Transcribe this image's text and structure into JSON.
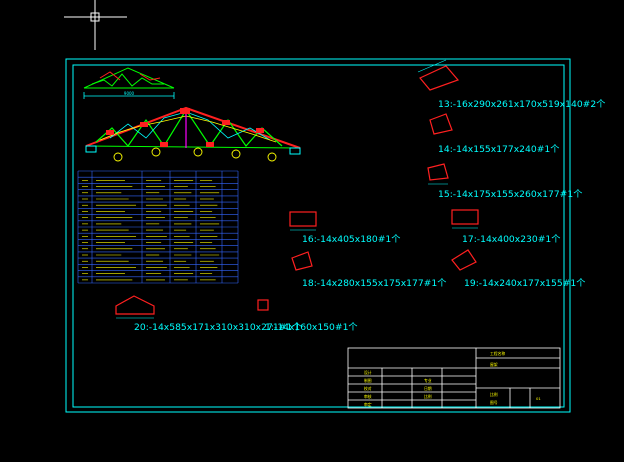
{
  "colors": {
    "background": "#000000",
    "frame": "#00ffff",
    "plate": "#ff2020",
    "member": "#00ff00",
    "accent": "#ffff00",
    "bolt": "#ff00ff",
    "table_line": "#3366ff",
    "crosshair": "#ffffff"
  },
  "cursor": {
    "icon": "crosshair-cursor-icon"
  },
  "parts": [
    {
      "id": "13",
      "label": "13:-16x290x261x170x519x140#2个"
    },
    {
      "id": "14",
      "label": "14:-14x155x177x240#1个"
    },
    {
      "id": "15",
      "label": "15:-14x175x155x260x177#1个"
    },
    {
      "id": "16",
      "label": "16:-14x405x180#1个"
    },
    {
      "id": "17",
      "label": "17:-14x400x230#1个"
    },
    {
      "id": "18",
      "label": "18:-14x280x155x175x177#1个"
    },
    {
      "id": "19",
      "label": "19:-14x240x177x155#1个"
    },
    {
      "id": "20",
      "label": "20:-14x585x171x310x310x271#1个"
    },
    {
      "id": "21",
      "label": "1:-14x160x150#1个"
    }
  ],
  "truss": {
    "dimension_top": "9000"
  },
  "title_block": {
    "project": "工程名称",
    "drawing_name": "屋架",
    "scale_label": "比例",
    "sheet_label": "图号",
    "sheet_value": "01",
    "rows": [
      "设计",
      "制图",
      "校对",
      "审核",
      "审定"
    ],
    "col2": [
      "",
      "",
      "专业",
      "日期",
      "比例"
    ]
  },
  "table": {
    "headers": [
      "编号",
      "规格",
      "长度(mm)",
      "数量",
      "重量(kg)",
      "备注"
    ],
    "row_count": 17
  }
}
